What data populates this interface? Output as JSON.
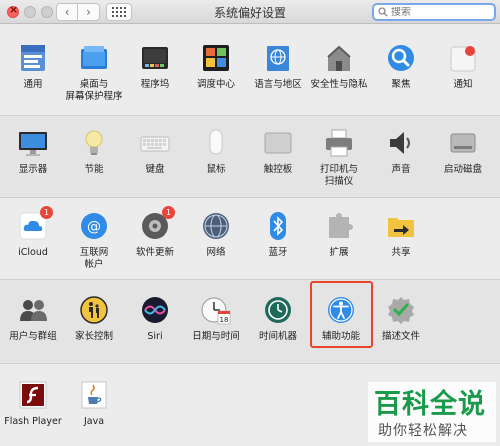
{
  "window": {
    "title": "系统偏好设置"
  },
  "search": {
    "placeholder": "搜索"
  },
  "rows": [
    {
      "panes": [
        {
          "label": "通用",
          "icon": "general-icon"
        },
        {
          "label": "桌面与\n屏幕保护程序",
          "icon": "desktop-icon"
        },
        {
          "label": "程序坞",
          "icon": "dock-icon"
        },
        {
          "label": "调度中心",
          "icon": "mission-control-icon"
        },
        {
          "label": "语言与地区",
          "icon": "language-region-icon"
        },
        {
          "label": "安全性与隐私",
          "icon": "security-icon"
        },
        {
          "label": "聚焦",
          "icon": "spotlight-icon"
        },
        {
          "label": "通知",
          "icon": "notifications-icon"
        }
      ]
    },
    {
      "panes": [
        {
          "label": "显示器",
          "icon": "display-icon"
        },
        {
          "label": "节能",
          "icon": "energy-saver-icon"
        },
        {
          "label": "键盘",
          "icon": "keyboard-icon"
        },
        {
          "label": "鼠标",
          "icon": "mouse-icon"
        },
        {
          "label": "触控板",
          "icon": "trackpad-icon"
        },
        {
          "label": "打印机与\n扫描仪",
          "icon": "printer-icon"
        },
        {
          "label": "声音",
          "icon": "sound-icon"
        },
        {
          "label": "启动磁盘",
          "icon": "startup-disk-icon"
        }
      ]
    },
    {
      "panes": [
        {
          "label": "iCloud",
          "icon": "icloud-icon",
          "badge": "1"
        },
        {
          "label": "互联网\n帐户",
          "icon": "internet-accounts-icon"
        },
        {
          "label": "软件更新",
          "icon": "software-update-icon",
          "badge": "1"
        },
        {
          "label": "网络",
          "icon": "network-icon"
        },
        {
          "label": "蓝牙",
          "icon": "bluetooth-icon"
        },
        {
          "label": "扩展",
          "icon": "extensions-icon"
        },
        {
          "label": "共享",
          "icon": "sharing-icon"
        }
      ]
    },
    {
      "panes": [
        {
          "label": "用户与群组",
          "icon": "users-icon"
        },
        {
          "label": "家长控制",
          "icon": "parental-controls-icon"
        },
        {
          "label": "Siri",
          "icon": "siri-icon"
        },
        {
          "label": "日期与时间",
          "icon": "date-time-icon",
          "date_text": "18"
        },
        {
          "label": "时间机器",
          "icon": "time-machine-icon"
        },
        {
          "label": "辅助功能",
          "icon": "accessibility-icon"
        },
        {
          "label": "描述文件",
          "icon": "profiles-icon"
        }
      ]
    },
    {
      "panes": [
        {
          "label": "Flash Player",
          "icon": "flash-player-icon"
        },
        {
          "label": "Java",
          "icon": "java-icon"
        }
      ]
    }
  ],
  "watermark": {
    "line1": "百科全说",
    "line2": "助你轻松解决"
  }
}
